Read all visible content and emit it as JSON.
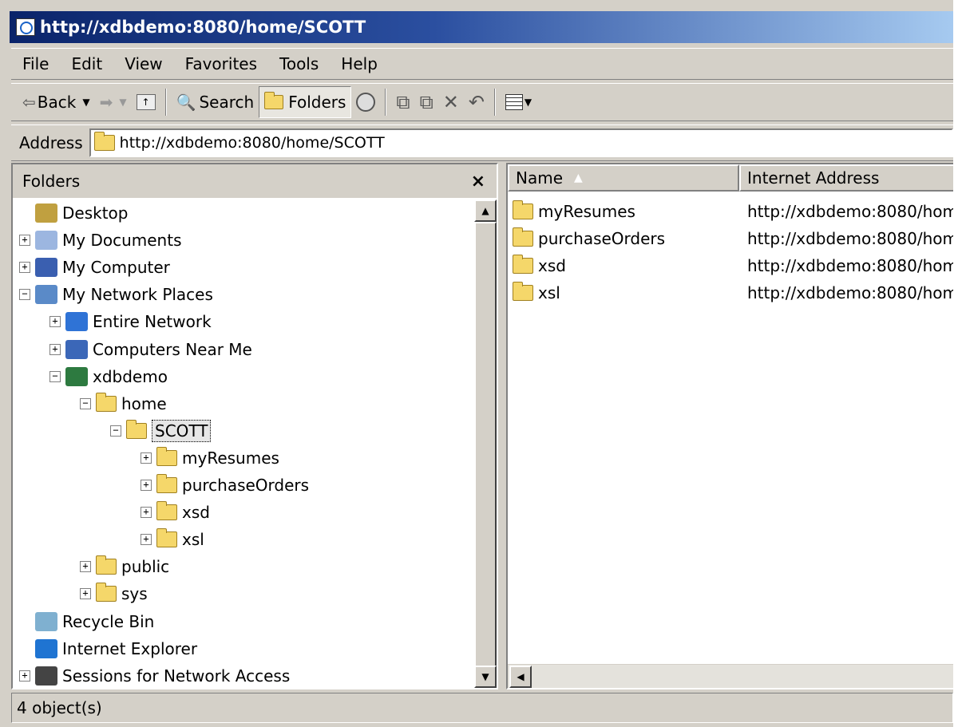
{
  "window": {
    "title": "http://xdbdemo:8080/home/SCOTT"
  },
  "menu": [
    "File",
    "Edit",
    "View",
    "Favorites",
    "Tools",
    "Help"
  ],
  "toolbar": {
    "back": "Back",
    "search": "Search",
    "folders": "Folders"
  },
  "address": {
    "label": "Address",
    "value": "http://xdbdemo:8080/home/SCOTT"
  },
  "folders_pane": {
    "title": "Folders",
    "close": "×",
    "tree": [
      {
        "label": "Desktop",
        "icon": "desktop-icon",
        "expander": ""
      },
      {
        "label": "My Documents",
        "icon": "my-documents-icon",
        "expander": "+"
      },
      {
        "label": "My Computer",
        "icon": "computer-icon",
        "expander": "+"
      },
      {
        "label": "My Network Places",
        "icon": "network-places-icon",
        "expander": "−"
      },
      {
        "label": "Entire Network",
        "icon": "globe-icon",
        "expander": "+"
      },
      {
        "label": "Computers Near Me",
        "icon": "workgroup-icon",
        "expander": "+"
      },
      {
        "label": "xdbdemo",
        "icon": "server-icon",
        "expander": "−"
      },
      {
        "label": "home",
        "icon": "folder-icon",
        "expander": "−"
      },
      {
        "label": "SCOTT",
        "icon": "folder-icon",
        "expander": "−",
        "selected": true
      },
      {
        "label": "myResumes",
        "icon": "folder-icon",
        "expander": "+"
      },
      {
        "label": "purchaseOrders",
        "icon": "folder-icon",
        "expander": "+"
      },
      {
        "label": "xsd",
        "icon": "folder-icon",
        "expander": "+"
      },
      {
        "label": "xsl",
        "icon": "folder-icon",
        "expander": "+"
      },
      {
        "label": "public",
        "icon": "folder-icon",
        "expander": "+"
      },
      {
        "label": "sys",
        "icon": "folder-icon",
        "expander": "+"
      },
      {
        "label": "Recycle Bin",
        "icon": "recycle-bin-icon",
        "expander": ""
      },
      {
        "label": "Internet Explorer",
        "icon": "internet-explorer-icon",
        "expander": ""
      },
      {
        "label": "Sessions for Network Access",
        "icon": "sessions-icon",
        "expander": "+"
      }
    ]
  },
  "list": {
    "columns": [
      "Name",
      "Internet Address"
    ],
    "rows": [
      {
        "name": "myResumes",
        "address": "http://xdbdemo:8080/hom"
      },
      {
        "name": "purchaseOrders",
        "address": "http://xdbdemo:8080/hom"
      },
      {
        "name": "xsd",
        "address": "http://xdbdemo:8080/hom"
      },
      {
        "name": "xsl",
        "address": "http://xdbdemo:8080/hom"
      }
    ]
  },
  "status": {
    "text": "4 object(s)"
  },
  "colors": {
    "title_start": "#0a246a",
    "title_end": "#a6caf0",
    "chrome": "#d4d0c8",
    "folder": "#f5d76a"
  }
}
